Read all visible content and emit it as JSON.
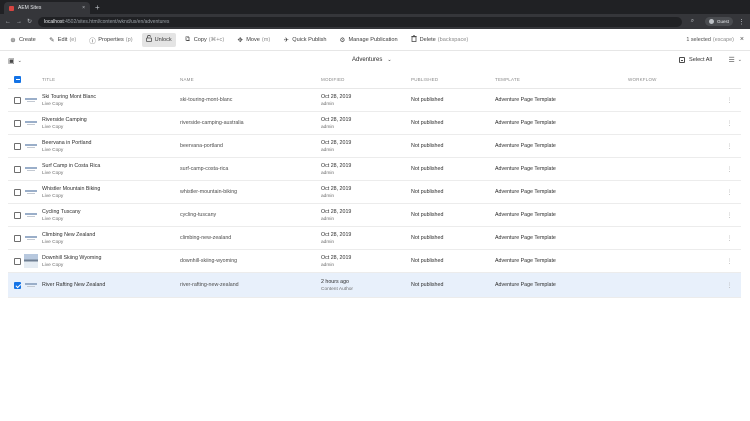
{
  "browser": {
    "tab_title": "AEM Sites",
    "tab_close": "×",
    "new_tab": "+",
    "back": "←",
    "forward": "→",
    "reload": "↻",
    "url_host": "localhost",
    "url_rest": ":4502/sites.html/content/wknd/us/en/adventures",
    "search_icon": "⌕",
    "profile": "Guest",
    "menu": "⋮"
  },
  "toolbar": {
    "create": "Create",
    "edit": "Edit",
    "edit_sc": "(e)",
    "properties": "Properties",
    "properties_sc": "(p)",
    "unlock": "Unlock",
    "copy": "Copy",
    "copy_sc": "(⌘+c)",
    "move": "Move",
    "move_sc": "(m)",
    "quick_publish": "Quick Publish",
    "manage_publication": "Manage Publication",
    "delete": "Delete",
    "delete_sc": "(backspace)",
    "selected_info": "1 selected",
    "selected_sc": "(escape)",
    "close": "×"
  },
  "subheader": {
    "folder_title": "Adventures",
    "select_all": "Select All"
  },
  "columns": {
    "title": "TITLE",
    "name": "NAME",
    "modified": "MODIFIED",
    "published": "PUBLISHED",
    "template": "TEMPLATE",
    "workflow": "WORKFLOW"
  },
  "rows": [
    {
      "title": "Ski Touring Mont Blanc",
      "sub": "Live Copy",
      "name": "ski-touring-mont-blanc",
      "modified": "Oct 28, 2019",
      "by": "admin",
      "published": "Not published",
      "template": "Adventure Page Template",
      "more": "⋮"
    },
    {
      "title": "Riverside Camping",
      "sub": "Live Copy",
      "name": "riverside-camping-australia",
      "modified": "Oct 28, 2019",
      "by": "admin",
      "published": "Not published",
      "template": "Adventure Page Template",
      "more": "⋮"
    },
    {
      "title": "Beervana in Portland",
      "sub": "Live Copy",
      "name": "beervana-portland",
      "modified": "Oct 28, 2019",
      "by": "admin",
      "published": "Not published",
      "template": "Adventure Page Template",
      "more": "⋮"
    },
    {
      "title": "Surf Camp in Costa Rica",
      "sub": "Live Copy",
      "name": "surf-camp-costa-rica",
      "modified": "Oct 28, 2019",
      "by": "admin",
      "published": "Not published",
      "template": "Adventure Page Template",
      "more": "⋮"
    },
    {
      "title": "Whistler Mountain Biking",
      "sub": "Live Copy",
      "name": "whistler-mountain-biking",
      "modified": "Oct 28, 2019",
      "by": "admin",
      "published": "Not published",
      "template": "Adventure Page Template",
      "more": "⋮"
    },
    {
      "title": "Cycling Tuscany",
      "sub": "Live Copy",
      "name": "cycling-tuscany",
      "modified": "Oct 28, 2019",
      "by": "admin",
      "published": "Not published",
      "template": "Adventure Page Template",
      "more": "⋮"
    },
    {
      "title": "Climbing New Zealand",
      "sub": "Live Copy",
      "name": "climbing-new-zealand",
      "modified": "Oct 28, 2019",
      "by": "admin",
      "published": "Not published",
      "template": "Adventure Page Template",
      "more": "⋮"
    },
    {
      "title": "Downhill Skiing Wyoming",
      "sub": "Live Copy",
      "name": "downhill-skiing-wyoming",
      "modified": "Oct 28, 2019",
      "by": "admin",
      "published": "Not published",
      "template": "Adventure Page Template",
      "more": "⋮"
    },
    {
      "title": "River Rafting New Zealand",
      "sub": "",
      "name": "river-rafting-new-zealand",
      "modified": "2 hours ago",
      "by": "Content Author",
      "published": "Not published",
      "template": "Adventure Page Template",
      "more": "⋮"
    }
  ],
  "icons": {
    "create": "⊕",
    "edit": "✎",
    "properties": "ⓘ",
    "unlock": "🔓",
    "copy": "⧉",
    "move": "✥",
    "quick_publish": "✈",
    "manage_publication": "⚙",
    "delete": "🗑",
    "rail": "▣",
    "chevron": "⌄",
    "list_view": "☰"
  },
  "colors": {
    "accent": "#1473e6",
    "selected_row": "#e8f0fb"
  }
}
